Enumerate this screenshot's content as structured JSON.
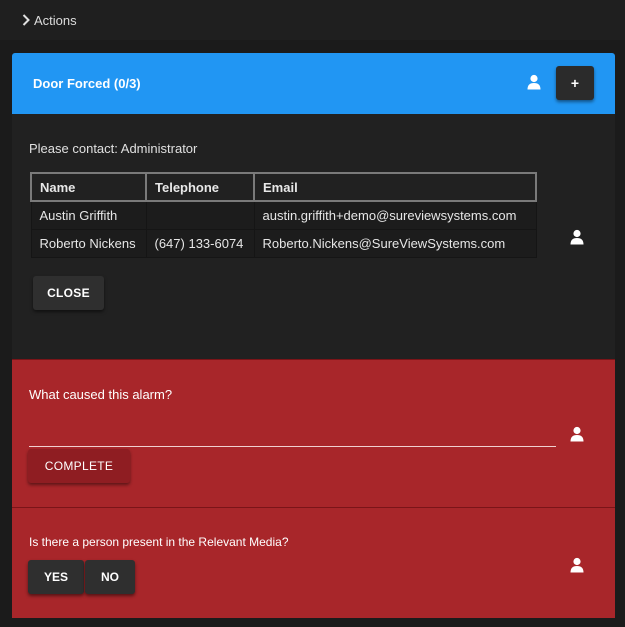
{
  "actions": {
    "label": "Actions",
    "icon": "chevron-right-icon"
  },
  "alarm": {
    "title": "Door Forced (0/3)",
    "add_label": "+",
    "header_color": "#2196f3"
  },
  "contact": {
    "text": "Please contact: Administrator",
    "columns": [
      "Name",
      "Telephone",
      "Email"
    ],
    "rows": [
      {
        "name": "Austin Griffith",
        "telephone": "",
        "email": "austin.griffith+demo@sureviewsystems.com"
      },
      {
        "name": "Roberto Nickens",
        "telephone": "(647) 133-6074",
        "email": "Roberto.Nickens@SureViewSystems.com"
      }
    ],
    "close_label": "CLOSE"
  },
  "question1": {
    "text": "What caused this alarm?",
    "value": "",
    "complete_label": "COMPLETE",
    "color": "#a8262a"
  },
  "question2": {
    "text": "Is there a person present in the Relevant Media?",
    "yes_label": "YES",
    "no_label": "NO"
  }
}
